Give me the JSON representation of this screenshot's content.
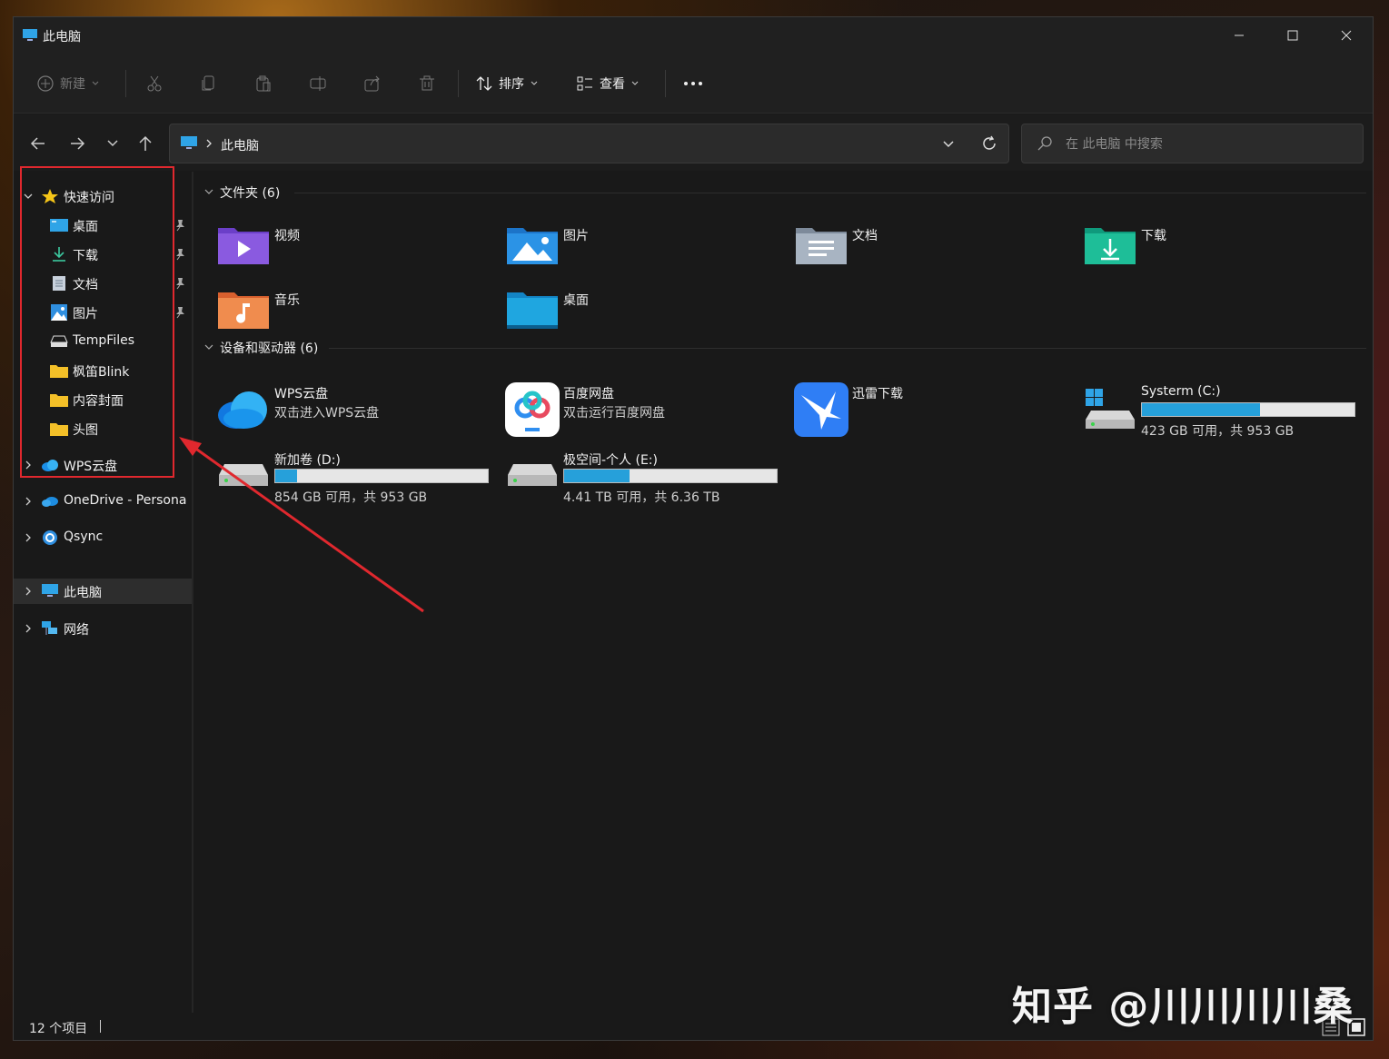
{
  "window": {
    "title": "此电脑"
  },
  "toolbar": {
    "new_label": "新建",
    "sort_label": "排序",
    "view_label": "查看",
    "more_icon": "ellipsis-icon"
  },
  "address": {
    "path": "此电脑",
    "search_placeholder": "在 此电脑 中搜索"
  },
  "sidebar": {
    "quick_access": "快速访问",
    "pinned": [
      {
        "label": "桌面",
        "icon": "desktop-icon"
      },
      {
        "label": "下载",
        "icon": "download-icon"
      },
      {
        "label": "文档",
        "icon": "document-icon"
      },
      {
        "label": "图片",
        "icon": "picture-icon"
      }
    ],
    "recent": [
      {
        "label": "TempFiles",
        "icon": "drive-icon"
      },
      {
        "label": "枫笛Blink",
        "icon": "folder-icon"
      },
      {
        "label": "内容封面",
        "icon": "folder-icon"
      },
      {
        "label": "头图",
        "icon": "folder-icon"
      }
    ],
    "roots": [
      {
        "label": "WPS云盘",
        "icon": "wps-cloud-icon"
      },
      {
        "label": "OneDrive - Persona",
        "icon": "onedrive-icon"
      },
      {
        "label": "Qsync",
        "icon": "qsync-icon"
      },
      {
        "label": "此电脑",
        "icon": "computer-icon"
      },
      {
        "label": "网络",
        "icon": "network-icon"
      }
    ]
  },
  "folders": {
    "header": "文件夹 (6)",
    "items": [
      {
        "label": "视频",
        "icon": "video-folder-icon"
      },
      {
        "label": "图片",
        "icon": "pictures-folder-icon"
      },
      {
        "label": "文档",
        "icon": "documents-folder-icon"
      },
      {
        "label": "下载",
        "icon": "downloads-folder-icon"
      },
      {
        "label": "音乐",
        "icon": "music-folder-icon"
      },
      {
        "label": "桌面",
        "icon": "desktop-folder-icon"
      }
    ]
  },
  "devices": {
    "header": "设备和驱动器 (6)",
    "items": [
      {
        "label": "WPS云盘",
        "sub": "双击进入WPS云盘",
        "icon": "wps-cloud-icon"
      },
      {
        "label": "百度网盘",
        "sub": "双击运行百度网盘",
        "icon": "baidu-netdisk-icon"
      },
      {
        "label": "迅雷下载",
        "sub": "",
        "icon": "xunlei-icon"
      },
      {
        "label": "Systerm (C:)",
        "sub": "423 GB 可用，共 953 GB",
        "icon": "system-drive-icon",
        "used_fraction": 0.556
      },
      {
        "label": "新加卷 (D:)",
        "sub": "854 GB 可用，共 953 GB",
        "icon": "drive-icon",
        "used_fraction": 0.104
      },
      {
        "label": "极空间-个人 (E:)",
        "sub": "4.41 TB 可用，共 6.36 TB",
        "icon": "drive-icon",
        "used_fraction": 0.307
      }
    ]
  },
  "status": {
    "count": "12 个项目"
  },
  "watermark": "知乎 @川川川川桑",
  "colors": {
    "highlight": "#e0282e",
    "accent": "#26a0da",
    "window_bg": "#191919"
  }
}
